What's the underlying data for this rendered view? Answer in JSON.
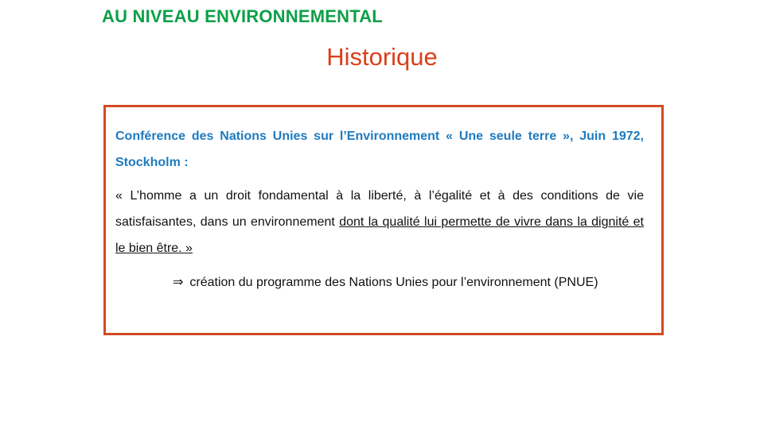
{
  "slide": {
    "section_title": "AU NIVEAU ENVIRONNEMENTAL",
    "title": "Historique"
  },
  "box": {
    "conference": "Conférence des Nations Unies sur l’Environnement « Une seule terre », Juin 1972, Stockholm :",
    "quote_plain": "« L’homme a un droit fondamental à la liberté, à l’égalité et à des conditions de vie satisfaisantes, dans un environnement ",
    "quote_underlined": "dont la qualité lui permette de vivre dans la dignité et le bien être. »",
    "consequence_icon": "implies-arrow-icon",
    "consequence_arrow": "⇒",
    "consequence": "création du programme des Nations Unies pour l’environnement (PNUE)"
  },
  "colors": {
    "section_title": "#0da048",
    "title": "#d9401b",
    "box_border": "#d24a22",
    "conference_text": "#1f7bbf",
    "body_text": "#111111"
  }
}
